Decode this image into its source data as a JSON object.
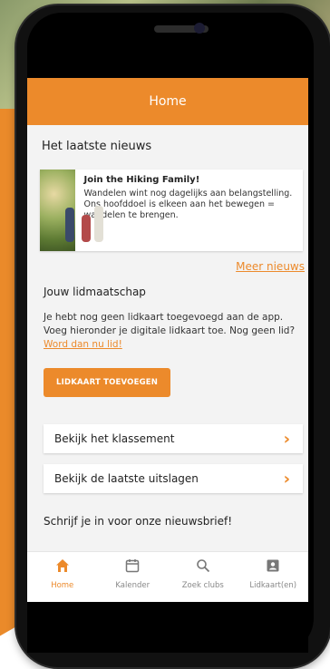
{
  "header": {
    "title": "Home"
  },
  "news": {
    "section_title": "Het laatste nieuws",
    "items": [
      {
        "title": "Join the Hiking Family!",
        "body": "Wandelen wint nog dagelijks aan belangstelling. Ons hoofddoel is elkeen aan het bewegen = wandelen te brengen."
      }
    ],
    "more_link": "Meer nieuws"
  },
  "membership": {
    "title": "Jouw lidmaatschap",
    "body": "Je hebt nog geen lidkaart toegevoegd aan de app. Voeg hieronder je digitale lidkaart toe. Nog geen lid?",
    "join_link": "Word dan nu lid!",
    "add_button": "LIDKAART TOEVOEGEN"
  },
  "links": [
    {
      "label": "Bekijk het klassement"
    },
    {
      "label": "Bekijk de laatste uitslagen"
    }
  ],
  "newsletter": {
    "title": "Schrijf je in voor onze nieuwsbrief!"
  },
  "tabbar": [
    {
      "label": "Home",
      "icon": "home-icon",
      "active": true
    },
    {
      "label": "Kalender",
      "icon": "calendar-icon",
      "active": false
    },
    {
      "label": "Zoek clubs",
      "icon": "search-icon",
      "active": false
    },
    {
      "label": "Lidkaart(en)",
      "icon": "id-card-icon",
      "active": false
    }
  ],
  "colors": {
    "accent": "#ec8a2b",
    "background": "#f3f3f3",
    "card": "#ffffff"
  }
}
